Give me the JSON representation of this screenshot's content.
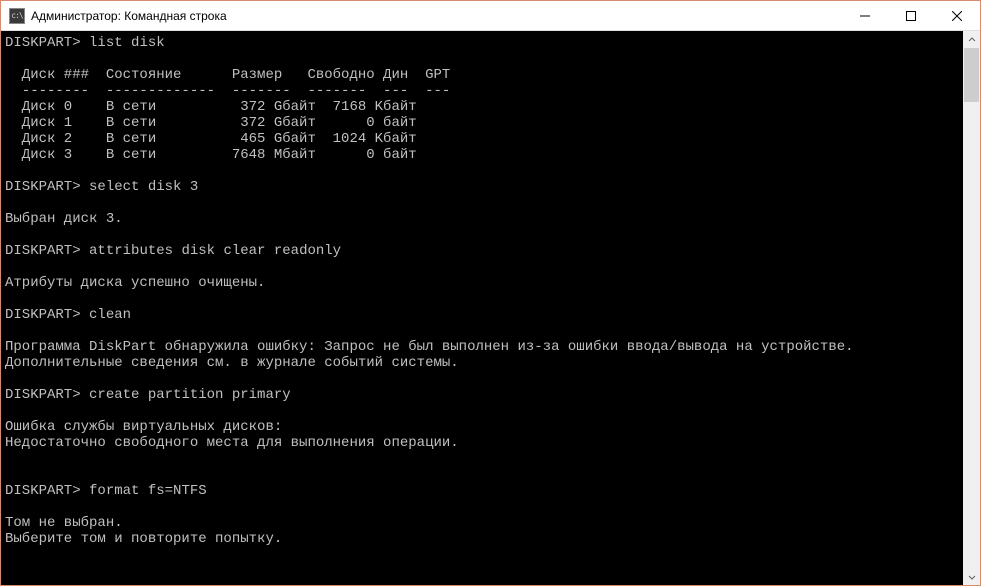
{
  "titlebar": {
    "icon_text": "C:\\",
    "title": "Администратор: Командная строка"
  },
  "terminal": {
    "prompt": "DISKPART>",
    "commands": {
      "list_disk": "list disk",
      "select_disk": "select disk 3",
      "attributes": "attributes disk clear readonly",
      "clean": "clean",
      "create_partition": "create partition primary",
      "format": "format fs=NTFS"
    },
    "table": {
      "header": "  Диск ###  Состояние      Размер   Свободно Дин  GPT",
      "divider": "  --------  -------------  -------  -------  ---  ---",
      "rows": [
        "  Диск 0    В сети          372 Gбайт  7168 Kбайт",
        "  Диск 1    В сети          372 Gбайт      0 байт",
        "  Диск 2    В сети          465 Gбайт  1024 Kбайт",
        "  Диск 3    В сети         7648 Mбайт      0 байт"
      ]
    },
    "messages": {
      "selected": "Выбран диск 3.",
      "attributes_cleared": "Атрибуты диска успешно очищены.",
      "clean_error_1": "Программа DiskPart обнаружила ошибку: Запрос не был выполнен из-за ошибки ввода/вывода на устройстве.",
      "clean_error_2": "Дополнительные сведения см. в журнале событий системы.",
      "vds_error_1": "Ошибка службы виртуальных дисков:",
      "vds_error_2": "Недостаточно свободного места для выполнения операции.",
      "no_volume_1": "Том не выбран.",
      "no_volume_2": "Выберите том и повторите попытку."
    }
  }
}
